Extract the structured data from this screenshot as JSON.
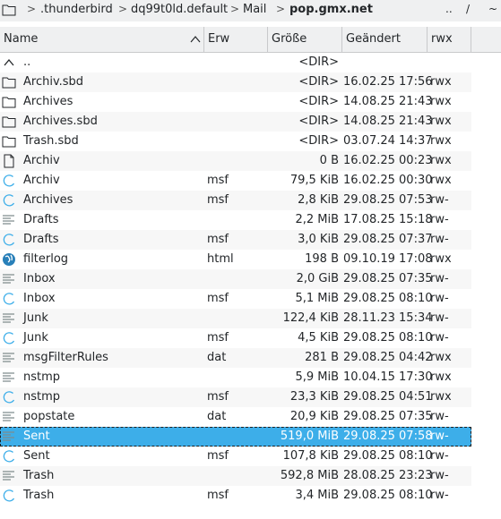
{
  "breadcrumb": {
    "items": [
      ".thunderbird",
      "dq99t0ld.default",
      "Mail",
      "pop.gmx.net"
    ],
    "up_label": "..",
    "root_label": "/"
  },
  "columns": {
    "name": "Name",
    "ext": "Erw",
    "size": "Größe",
    "modified": "Geändert",
    "perms": "rwx"
  },
  "rows": [
    {
      "icon": "up-icon",
      "name": "..",
      "ext": "",
      "size": "<DIR>",
      "date": "",
      "perms": ""
    },
    {
      "icon": "folder-icon",
      "name": "Archiv.sbd",
      "ext": "",
      "size": "<DIR>",
      "date": "16.02.25 17:56",
      "perms": "rwx"
    },
    {
      "icon": "folder-icon",
      "name": "Archives",
      "ext": "",
      "size": "<DIR>",
      "date": "14.08.25 21:43",
      "perms": "rwx"
    },
    {
      "icon": "folder-icon",
      "name": "Archives.sbd",
      "ext": "",
      "size": "<DIR>",
      "date": "14.08.25 21:43",
      "perms": "rwx"
    },
    {
      "icon": "folder-icon",
      "name": "Trash.sbd",
      "ext": "",
      "size": "<DIR>",
      "date": "03.07.24 14:37",
      "perms": "rwx"
    },
    {
      "icon": "file-icon",
      "name": "Archiv",
      "ext": "",
      "size": "0 B",
      "date": "16.02.25 00:23",
      "perms": "rwx"
    },
    {
      "icon": "loading-icon",
      "name": "Archiv",
      "ext": "msf",
      "size": "79,5 KiB",
      "date": "16.02.25 00:30",
      "perms": "rwx"
    },
    {
      "icon": "loading-icon",
      "name": "Archives",
      "ext": "msf",
      "size": "2,8 KiB",
      "date": "29.08.25 07:53",
      "perms": "rw-"
    },
    {
      "icon": "text-icon",
      "name": "Drafts",
      "ext": "",
      "size": "2,2 MiB",
      "date": "17.08.25 15:18",
      "perms": "rw-"
    },
    {
      "icon": "loading-icon",
      "name": "Drafts",
      "ext": "msf",
      "size": "3,0 KiB",
      "date": "29.08.25 07:37",
      "perms": "rw-"
    },
    {
      "icon": "globe-icon",
      "name": "filterlog",
      "ext": "html",
      "size": "198 B",
      "date": "09.10.19 17:08",
      "perms": "rwx"
    },
    {
      "icon": "text-icon",
      "name": "Inbox",
      "ext": "",
      "size": "2,0 GiB",
      "date": "29.08.25 07:35",
      "perms": "rw-"
    },
    {
      "icon": "loading-icon",
      "name": "Inbox",
      "ext": "msf",
      "size": "5,1 MiB",
      "date": "29.08.25 08:10",
      "perms": "rw-"
    },
    {
      "icon": "text-icon",
      "name": "Junk",
      "ext": "",
      "size": "122,4 KiB",
      "date": "28.11.23 15:34",
      "perms": "rw-"
    },
    {
      "icon": "loading-icon",
      "name": "Junk",
      "ext": "msf",
      "size": "4,5 KiB",
      "date": "29.08.25 08:10",
      "perms": "rw-"
    },
    {
      "icon": "text-icon",
      "name": "msgFilterRules",
      "ext": "dat",
      "size": "281 B",
      "date": "29.08.25 04:42",
      "perms": "rwx"
    },
    {
      "icon": "text-icon",
      "name": "nstmp",
      "ext": "",
      "size": "5,9 MiB",
      "date": "10.04.15 17:30",
      "perms": "rwx"
    },
    {
      "icon": "loading-icon",
      "name": "nstmp",
      "ext": "msf",
      "size": "23,3 KiB",
      "date": "29.08.25 04:51",
      "perms": "rwx"
    },
    {
      "icon": "text-icon",
      "name": "popstate",
      "ext": "dat",
      "size": "20,9 KiB",
      "date": "29.08.25 07:35",
      "perms": "rw-"
    },
    {
      "icon": "text-icon",
      "name": "Sent",
      "ext": "",
      "size": "519,0 MiB",
      "date": "29.08.25 07:58",
      "perms": "rw-",
      "selected": true
    },
    {
      "icon": "loading-icon",
      "name": "Sent",
      "ext": "msf",
      "size": "107,8 KiB",
      "date": "29.08.25 08:10",
      "perms": "rw-"
    },
    {
      "icon": "text-icon",
      "name": "Trash",
      "ext": "",
      "size": "592,8 MiB",
      "date": "28.08.25 23:23",
      "perms": "rw-"
    },
    {
      "icon": "loading-icon",
      "name": "Trash",
      "ext": "msf",
      "size": "3,4 MiB",
      "date": "29.08.25 08:10",
      "perms": "rw-"
    }
  ],
  "colors": {
    "selection": "#3daee9",
    "accent_icon": "#3daee9",
    "globe_icon": "#2980b9"
  }
}
